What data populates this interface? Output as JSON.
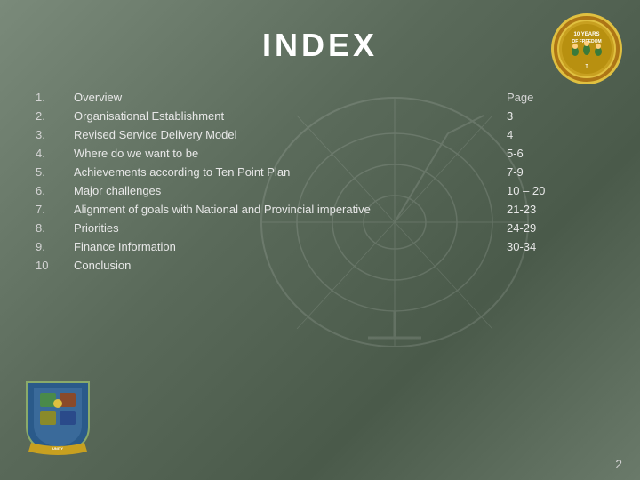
{
  "slide": {
    "title": "INDEX",
    "page_number": "2",
    "top_logo_text": "10 YEARS OF FREEDOM",
    "items": [
      {
        "number": "1.",
        "label": "Overview",
        "page": "3"
      },
      {
        "number": "2.",
        "label": "Organisational Establishment",
        "page": "4"
      },
      {
        "number": "3.",
        "label": "Revised Service Delivery Model",
        "page": "5-6"
      },
      {
        "number": "4.",
        "label": "Where do we want to be",
        "page": "7-9"
      },
      {
        "number": "5.",
        "label": "Achievements according to Ten Point Plan",
        "page": "10 – 20"
      },
      {
        "number": "6.",
        "label": "Major challenges",
        "page": "21-23"
      },
      {
        "number": "7.",
        "label": "Alignment of goals with National and Provincial imperative",
        "page": "24-29"
      },
      {
        "number": "8.",
        "label": "Priorities",
        "page": "30-34"
      },
      {
        "number": "9.",
        "label": "Finance Information",
        "page": ""
      },
      {
        "number": "10",
        "label": "Conclusion",
        "page": ""
      }
    ],
    "page_column_header": "Page"
  }
}
